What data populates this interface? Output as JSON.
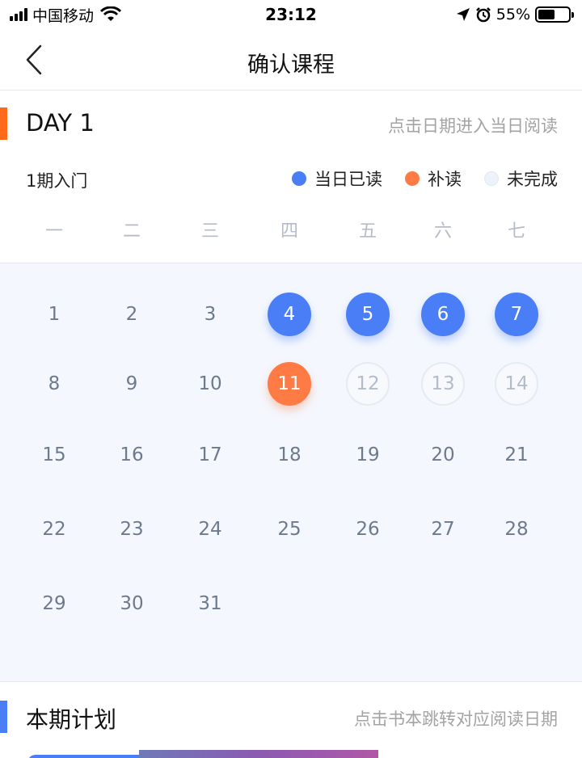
{
  "status_bar": {
    "carrier": "中国移动",
    "time": "23:12",
    "battery_percent": "55%",
    "battery_level": 0.55
  },
  "nav": {
    "title": "确认课程",
    "back_icon": "chevron-left-icon"
  },
  "day_section": {
    "title": "DAY 1",
    "hint": "点击日期进入当日阅读",
    "accent_color": "#ff6a1a"
  },
  "period_label": "1期入门",
  "legend": [
    {
      "label": "当日已读",
      "color": "#4a7ef6"
    },
    {
      "label": "补读",
      "color": "#ff7b46"
    },
    {
      "label": "未完成",
      "color": "#eef2fa"
    }
  ],
  "weekdays": [
    "一",
    "二",
    "三",
    "四",
    "五",
    "六",
    "七"
  ],
  "calendar": {
    "weeks": [
      [
        {
          "d": "1",
          "s": "normal"
        },
        {
          "d": "2",
          "s": "normal"
        },
        {
          "d": "3",
          "s": "normal"
        },
        {
          "d": "4",
          "s": "read"
        },
        {
          "d": "5",
          "s": "read"
        },
        {
          "d": "6",
          "s": "read"
        },
        {
          "d": "7",
          "s": "read"
        }
      ],
      [
        {
          "d": "8",
          "s": "normal"
        },
        {
          "d": "9",
          "s": "normal"
        },
        {
          "d": "10",
          "s": "normal"
        },
        {
          "d": "11",
          "s": "makeup"
        },
        {
          "d": "12",
          "s": "pending"
        },
        {
          "d": "13",
          "s": "pending"
        },
        {
          "d": "14",
          "s": "pending"
        }
      ],
      [
        {
          "d": "15",
          "s": "normal"
        },
        {
          "d": "16",
          "s": "normal"
        },
        {
          "d": "17",
          "s": "normal"
        },
        {
          "d": "18",
          "s": "normal"
        },
        {
          "d": "19",
          "s": "normal"
        },
        {
          "d": "20",
          "s": "normal"
        },
        {
          "d": "21",
          "s": "normal"
        }
      ],
      [
        {
          "d": "22",
          "s": "normal"
        },
        {
          "d": "23",
          "s": "normal"
        },
        {
          "d": "24",
          "s": "normal"
        },
        {
          "d": "25",
          "s": "normal"
        },
        {
          "d": "26",
          "s": "normal"
        },
        {
          "d": "27",
          "s": "normal"
        },
        {
          "d": "28",
          "s": "normal"
        }
      ],
      [
        {
          "d": "29",
          "s": "normal"
        },
        {
          "d": "30",
          "s": "normal"
        },
        {
          "d": "31",
          "s": "normal"
        }
      ]
    ]
  },
  "plan_section": {
    "title": "本期计划",
    "hint": "点击书本跳转对应阅读日期",
    "accent_color": "#4a7ef6"
  }
}
